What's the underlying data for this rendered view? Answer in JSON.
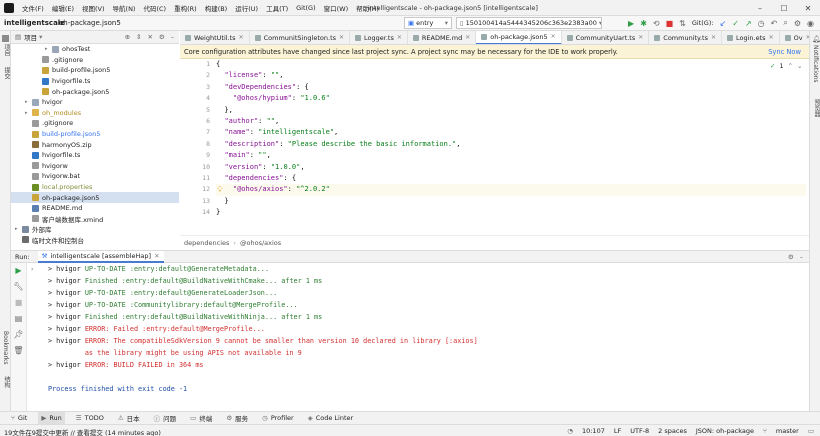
{
  "app": {
    "menus": [
      "文件(F)",
      "编辑(E)",
      "视图(V)",
      "导航(N)",
      "代码(C)",
      "重构(R)",
      "构建(B)",
      "运行(U)",
      "工具(T)",
      "Git(G)",
      "窗口(W)",
      "帮助(H)"
    ],
    "window_title": "intelligentscale - oh-package.json5 [intelligentscale]"
  },
  "toolbar": {
    "project": "intelligentscale",
    "file": "oh-package.json5",
    "module_select": "entry",
    "device_select": "150100414a5444345206c363e2383a00",
    "git_label": "Git(G):"
  },
  "project_panel": {
    "title": "项目",
    "tree": [
      {
        "label": "ohosTest",
        "depth": 3,
        "arrow": "▸",
        "icon": "folder",
        "sel": false
      },
      {
        "label": ".gitignore",
        "depth": 2,
        "arrow": "",
        "icon": "file",
        "sel": false
      },
      {
        "label": "build-profile.json5",
        "depth": 2,
        "arrow": "",
        "icon": "json",
        "sel": false
      },
      {
        "label": "hvigorfile.ts",
        "depth": 2,
        "arrow": "",
        "icon": "ts",
        "sel": false
      },
      {
        "label": "oh-package.json5",
        "depth": 2,
        "arrow": "",
        "icon": "json",
        "sel": false
      },
      {
        "label": "hvigor",
        "depth": 1,
        "arrow": "▸",
        "icon": "folder",
        "sel": false
      },
      {
        "label": "oh_modules",
        "depth": 1,
        "arrow": "▸",
        "icon": "folder-y",
        "sel": false
      },
      {
        "label": ".gitignore",
        "depth": 1,
        "arrow": "",
        "icon": "file",
        "sel": false
      },
      {
        "label": "build-profile.json5",
        "depth": 1,
        "arrow": "",
        "icon": "json",
        "sel": false
      },
      {
        "label": "harmonyOS.zip",
        "depth": 1,
        "arrow": "",
        "icon": "zip",
        "sel": false
      },
      {
        "label": "hvigorfile.ts",
        "depth": 1,
        "arrow": "",
        "icon": "ts",
        "sel": false
      },
      {
        "label": "hvigorw",
        "depth": 1,
        "arrow": "",
        "icon": "file",
        "sel": false
      },
      {
        "label": "hvigorw.bat",
        "depth": 1,
        "arrow": "",
        "icon": "file",
        "sel": false
      },
      {
        "label": "local.properties",
        "depth": 1,
        "arrow": "",
        "icon": "prop",
        "sel": false
      },
      {
        "label": "oh-package.json5",
        "depth": 1,
        "arrow": "",
        "icon": "json",
        "sel": true
      },
      {
        "label": "README.md",
        "depth": 1,
        "arrow": "",
        "icon": "md",
        "sel": false
      },
      {
        "label": "客户端数据库.xmind",
        "depth": 1,
        "arrow": "",
        "icon": "file",
        "sel": false
      },
      {
        "label": "外部库",
        "depth": 0,
        "arrow": "▸",
        "icon": "lib",
        "sel": false
      },
      {
        "label": "临时文件和控制台",
        "depth": 0,
        "arrow": "",
        "icon": "scratch",
        "sel": false
      }
    ]
  },
  "editor": {
    "tabs": [
      {
        "label": "WeightUtil.ts",
        "active": false
      },
      {
        "label": "CommunitSingleton.ts",
        "active": false
      },
      {
        "label": "Logger.ts",
        "active": false
      },
      {
        "label": "README.md",
        "active": false
      },
      {
        "label": "oh-package.json5",
        "active": true
      },
      {
        "label": "CommunityUart.ts",
        "active": false
      },
      {
        "label": "Community.ts",
        "active": false
      },
      {
        "label": "Login.ets",
        "active": false
      },
      {
        "label": "Ov",
        "active": false
      }
    ],
    "banner_message": "Core configuration attributes have changed since last project sync. A project sync may be necessary for the IDE to work properly.",
    "banner_action": "Sync Now",
    "inspection_count": "1",
    "line_numbers": [
      "1",
      "2",
      "3",
      "4",
      "5",
      "6",
      "7",
      "8",
      "9",
      "10",
      "11",
      "12",
      "13",
      "14"
    ],
    "code_lines": [
      [
        {
          "t": "{",
          "c": "p"
        }
      ],
      [
        {
          "t": "  ",
          "c": "p"
        },
        {
          "t": "\"license\"",
          "c": "k"
        },
        {
          "t": ": ",
          "c": "p"
        },
        {
          "t": "\"\"",
          "c": "s"
        },
        {
          "t": ",",
          "c": "p"
        }
      ],
      [
        {
          "t": "  ",
          "c": "p"
        },
        {
          "t": "\"devDependencies\"",
          "c": "k"
        },
        {
          "t": ": {",
          "c": "p"
        }
      ],
      [
        {
          "t": "    ",
          "c": "p"
        },
        {
          "t": "\"@ohos/hypium\"",
          "c": "k"
        },
        {
          "t": ": ",
          "c": "p"
        },
        {
          "t": "\"1.0.6\"",
          "c": "s"
        }
      ],
      [
        {
          "t": "  },",
          "c": "p"
        }
      ],
      [
        {
          "t": "  ",
          "c": "p"
        },
        {
          "t": "\"author\"",
          "c": "k"
        },
        {
          "t": ": ",
          "c": "p"
        },
        {
          "t": "\"\"",
          "c": "s"
        },
        {
          "t": ",",
          "c": "p"
        }
      ],
      [
        {
          "t": "  ",
          "c": "p"
        },
        {
          "t": "\"name\"",
          "c": "k"
        },
        {
          "t": ": ",
          "c": "p"
        },
        {
          "t": "\"intelligentscale\"",
          "c": "s"
        },
        {
          "t": ",",
          "c": "p"
        }
      ],
      [
        {
          "t": "  ",
          "c": "p"
        },
        {
          "t": "\"description\"",
          "c": "k"
        },
        {
          "t": ": ",
          "c": "p"
        },
        {
          "t": "\"Please describe the basic information.\"",
          "c": "s"
        },
        {
          "t": ",",
          "c": "p"
        }
      ],
      [
        {
          "t": "  ",
          "c": "p"
        },
        {
          "t": "\"main\"",
          "c": "k"
        },
        {
          "t": ": ",
          "c": "p"
        },
        {
          "t": "\"\"",
          "c": "s"
        },
        {
          "t": ",",
          "c": "p"
        }
      ],
      [
        {
          "t": "  ",
          "c": "p"
        },
        {
          "t": "\"version\"",
          "c": "k"
        },
        {
          "t": ": ",
          "c": "p"
        },
        {
          "t": "\"1.0.0\"",
          "c": "s"
        },
        {
          "t": ",",
          "c": "p"
        }
      ],
      [
        {
          "t": "  ",
          "c": "p"
        },
        {
          "t": "\"dependencies\"",
          "c": "k"
        },
        {
          "t": ": {",
          "c": "p"
        }
      ],
      [
        {
          "t": "    ",
          "c": "p"
        },
        {
          "t": "\"@ohos/axios\"",
          "c": "k"
        },
        {
          "t": ": ",
          "c": "p"
        },
        {
          "t": "\"^2.0.2\"",
          "c": "s"
        }
      ],
      [
        {
          "t": "  }",
          "c": "p"
        }
      ],
      [
        {
          "t": "}",
          "c": "p"
        }
      ]
    ],
    "breadcrumb": [
      "dependencies",
      "@ohos/axios"
    ]
  },
  "run_panel": {
    "label": "Run:",
    "tab": "intelligentscale [assembleHap]",
    "lines": [
      {
        "prefix": "> hvigor ",
        "text": "UP-TO-DATE :entry:default@GenerateMetadata...",
        "c": "green"
      },
      {
        "prefix": "> hvigor ",
        "text": "Finished :entry:default@BuildNativeWithCmake... after 1 ms",
        "c": "green"
      },
      {
        "prefix": "> hvigor ",
        "text": "UP-TO-DATE :entry:default@GenerateLoaderJson...",
        "c": "green"
      },
      {
        "prefix": "> hvigor ",
        "text": "UP-TO-DATE :Communitylibrary:default@MergeProfile...",
        "c": "green"
      },
      {
        "prefix": "> hvigor ",
        "text": "Finished :entry:default@BuildNativeWithNinja... after 1 ms",
        "c": "green"
      },
      {
        "prefix": "> hvigor ",
        "text": "ERROR: Failed :entry:default@MergeProfile...",
        "c": "red"
      },
      {
        "prefix": "> hvigor ",
        "text": "ERROR: The compatibleSdkVersion 9 cannot be smaller than version 10 declared in library [:axios]",
        "c": "red"
      },
      {
        "prefix": "",
        "text": "         as the library might be using APIS not available in 9",
        "c": "red"
      },
      {
        "prefix": "> hvigor ",
        "text": "ERROR: BUILD FAILED in 364 ms",
        "c": "red"
      },
      {
        "prefix": "",
        "text": "",
        "c": "red"
      },
      {
        "prefix": "",
        "text": "Process finished with exit code -1",
        "c": "blue"
      }
    ]
  },
  "bottom_tools": [
    "Git",
    "Run",
    "TODO",
    "日本",
    "问题",
    "终端",
    "服务",
    "Profiler",
    "Code Linter"
  ],
  "statusbar": {
    "message": "19文件在9提交中更新 // 查看提交 (14 minutes ago)",
    "position": "10:107",
    "line_sep": "LF",
    "encoding": "UTF-8",
    "indent": "2 spaces",
    "schema": "JSON: oh-package",
    "branch": "master"
  },
  "side_labels": {
    "left_top": "项目",
    "left_mid": "提交",
    "left_bottom": "Bookmarks",
    "left_bottom2": "结构",
    "right_top": "Notifications",
    "right_mid": "预览器"
  },
  "colors": {
    "accent": "#3574f0",
    "error": "#d32f2f",
    "success": "#2f7d32",
    "selection": "#d4dff0",
    "banner": "#fbf3d5"
  }
}
